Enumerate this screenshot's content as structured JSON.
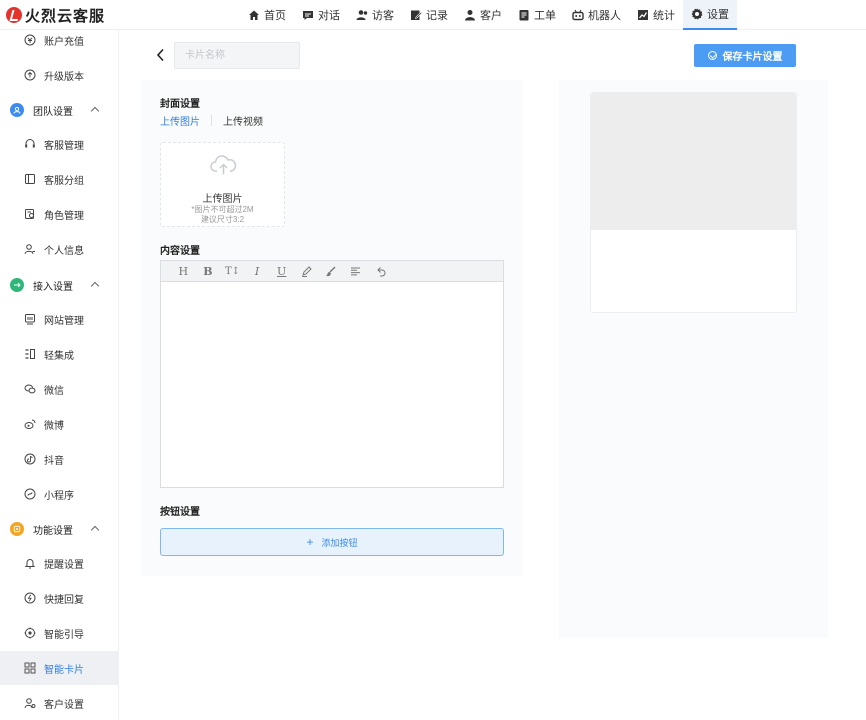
{
  "app": {
    "title": "火烈云客服"
  },
  "nav": {
    "items": [
      {
        "label": "首页",
        "icon": "home-icon"
      },
      {
        "label": "对话",
        "icon": "chat-icon"
      },
      {
        "label": "访客",
        "icon": "visitor-icon"
      },
      {
        "label": "记录",
        "icon": "record-icon"
      },
      {
        "label": "客户",
        "icon": "customer-icon"
      },
      {
        "label": "工单",
        "icon": "ticket-icon"
      },
      {
        "label": "机器人",
        "icon": "robot-icon"
      },
      {
        "label": "统计",
        "icon": "stats-icon"
      },
      {
        "label": "设置",
        "icon": "settings-icon",
        "active": true
      }
    ]
  },
  "sidebar": {
    "top_items": [
      {
        "label": "账户充值",
        "icon": "recharge-icon"
      },
      {
        "label": "升级版本",
        "icon": "upgrade-icon"
      }
    ],
    "groups": [
      {
        "label": "团队设置",
        "icon": "team-icon",
        "color": "#3d8bf0",
        "items": [
          {
            "label": "客服管理",
            "icon": "headset-icon"
          },
          {
            "label": "客服分组",
            "icon": "group-icon"
          },
          {
            "label": "角色管理",
            "icon": "role-icon"
          },
          {
            "label": "个人信息",
            "icon": "user-icon"
          }
        ]
      },
      {
        "label": "接入设置",
        "icon": "access-icon",
        "color": "#2fb77a",
        "items": [
          {
            "label": "网站管理",
            "icon": "website-icon"
          },
          {
            "label": "轻集成",
            "icon": "integration-icon"
          },
          {
            "label": "微信",
            "icon": "wechat-icon"
          },
          {
            "label": "微博",
            "icon": "weibo-icon"
          },
          {
            "label": "抖音",
            "icon": "douyin-icon"
          },
          {
            "label": "小程序",
            "icon": "miniprogram-icon"
          }
        ]
      },
      {
        "label": "功能设置",
        "icon": "function-icon",
        "color": "#f4a623",
        "items": [
          {
            "label": "提醒设置",
            "icon": "bell-icon"
          },
          {
            "label": "快捷回复",
            "icon": "quick-reply-icon"
          },
          {
            "label": "智能引导",
            "icon": "guide-icon"
          },
          {
            "label": "智能卡片",
            "icon": "card-icon",
            "active": true
          },
          {
            "label": "客户设置",
            "icon": "customer-settings-icon"
          }
        ]
      }
    ]
  },
  "main": {
    "name_input": {
      "placeholder": "卡片名称",
      "value": ""
    },
    "save_label": "保存卡片设置",
    "cover": {
      "title": "封面设置",
      "tabs": [
        {
          "label": "上传图片",
          "active": true
        },
        {
          "label": "上传视频",
          "active": false
        }
      ],
      "upload_title": "上传图片",
      "upload_hint1": "*图片不可超过2M",
      "upload_hint2": "建议尺寸3:2"
    },
    "content": {
      "title": "内容设置",
      "toolbar": [
        {
          "glyph": "H",
          "icon": "heading-icon"
        },
        {
          "glyph": "B",
          "icon": "bold-icon"
        },
        {
          "glyph": "T↕",
          "icon": "font-size-icon"
        },
        {
          "glyph": "I",
          "icon": "italic-icon"
        },
        {
          "glyph": "U",
          "icon": "underline-icon"
        },
        {
          "glyph": "✎",
          "icon": "highlight-icon"
        },
        {
          "glyph": "🖌",
          "icon": "brush-icon"
        },
        {
          "glyph": "≡",
          "icon": "align-icon"
        },
        {
          "glyph": "↶",
          "icon": "undo-icon"
        }
      ]
    },
    "buttons": {
      "title": "按钮设置",
      "add_label": "添加按钮"
    }
  }
}
